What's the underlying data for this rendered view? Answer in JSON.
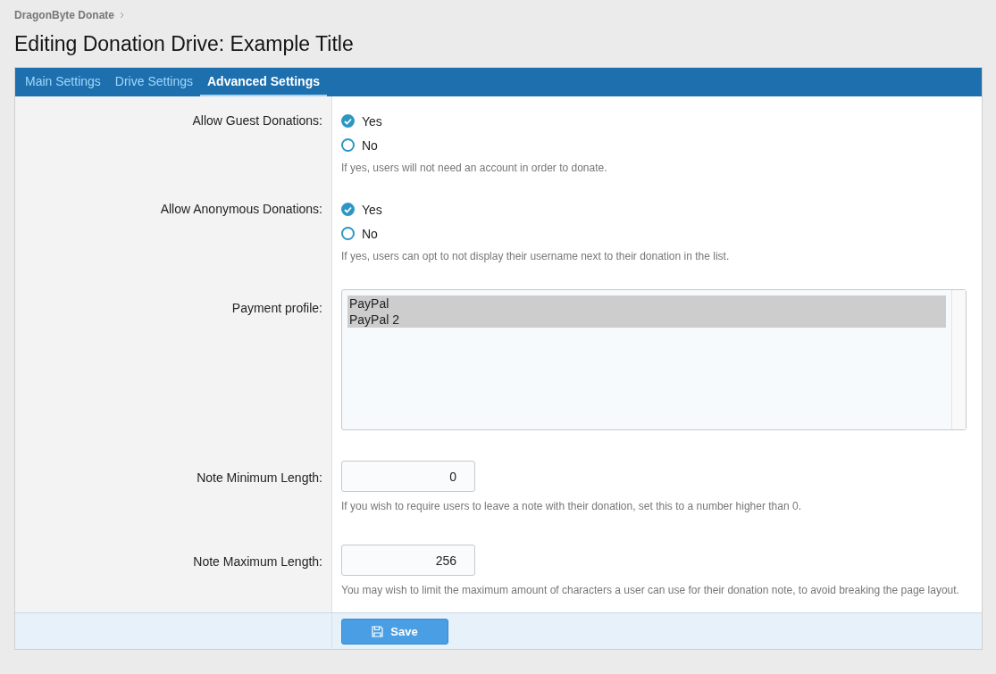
{
  "breadcrumb": {
    "items": [
      "DragonByte Donate"
    ]
  },
  "title": "Editing Donation Drive: Example Title",
  "tabs": [
    {
      "label": "Main Settings",
      "selected": false
    },
    {
      "label": "Drive Settings",
      "selected": false
    },
    {
      "label": "Advanced Settings",
      "selected": true
    }
  ],
  "rows": [
    {
      "kind": "radio",
      "label": "Allow Guest Donations:",
      "options": [
        {
          "label": "Yes",
          "selected": true
        },
        {
          "label": "No",
          "selected": false
        }
      ],
      "hint": "If yes, users will not need an account in order to donate."
    },
    {
      "kind": "radio",
      "label": "Allow Anonymous Donations:",
      "options": [
        {
          "label": "Yes",
          "selected": true
        },
        {
          "label": "No",
          "selected": false
        }
      ],
      "hint": "If yes, users can opt to not display their username next to their donation in the list."
    },
    {
      "kind": "listbox",
      "label": "Payment profile:",
      "options": [
        {
          "label": "PayPal",
          "selected": true
        },
        {
          "label": "PayPal 2",
          "selected": true
        }
      ]
    },
    {
      "kind": "number",
      "label": "Note Minimum Length:",
      "value": "0",
      "hint": "If you wish to require users to leave a note with their donation, set this to a number higher than 0."
    },
    {
      "kind": "number",
      "label": "Note Maximum Length:",
      "value": "256",
      "hint": "You may wish to limit the maximum amount of characters a user can use for their donation note, to avoid breaking the page layout."
    }
  ],
  "submit": {
    "label": "Save"
  }
}
